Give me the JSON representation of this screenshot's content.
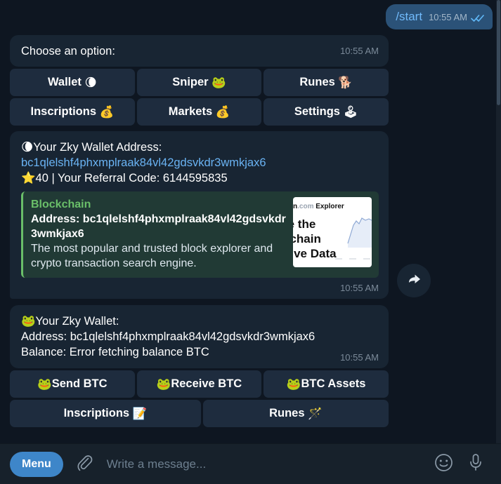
{
  "app": {
    "theme_background": "#0e1621"
  },
  "messages": {
    "outgoing": {
      "text": "/start",
      "time": "10:55 AM",
      "status_icon": "double-check-icon"
    },
    "choose_option": {
      "text": "Choose an option:",
      "time": "10:55 AM"
    },
    "wallet_address": {
      "line1_emoji": "🌘",
      "line1": "Your Zky Wallet Address:",
      "address": "bc1qlelshf4phxmplraak84vl42gdsvkdr3wmkjax6",
      "line3_emoji": "⭐",
      "line3": "40 | Your Referral Code: 6144595835",
      "time": "10:55 AM",
      "preview": {
        "site": "Blockchain",
        "title": "Address: bc1qlelshf4phxmplraak84vl42gdsvkdr3wmkjax6",
        "description": "The most popular and trusted block explorer and crypto transaction search engine.",
        "accent_color": "#6abf69",
        "thumbnail": {
          "brand": "chain",
          "brand_suffix": ".com",
          "brand_label": "Explorer",
          "headline_1": "re the",
          "headline_2": "kchain",
          "headline_3": "Live Data"
        }
      }
    },
    "wallet_summary": {
      "line1_emoji": "🐸",
      "line1": "Your Zky Wallet:",
      "line2": "Address: bc1qlelshf4phxmplraak84vl42gdsvkdr3wmkjax6",
      "line3": "Balance: Error fetching balance BTC",
      "time": "10:55 AM"
    }
  },
  "keyboard_main": {
    "rows": [
      [
        {
          "label": "Wallet",
          "emoji": "🌘"
        },
        {
          "label": "Sniper",
          "emoji": "🐸"
        },
        {
          "label": "Runes",
          "emoji": "🐕"
        }
      ],
      [
        {
          "label": "Inscriptions",
          "emoji": "💰"
        },
        {
          "label": "Markets",
          "emoji": "💰"
        },
        {
          "label": "Settings",
          "emoji": "🕹"
        }
      ]
    ]
  },
  "keyboard_wallet": {
    "rows": [
      [
        {
          "emoji": "🐸",
          "label": "Send BTC"
        },
        {
          "emoji": "🐸",
          "label": "Receive BTC"
        },
        {
          "emoji": "🐸",
          "label": "BTC Assets"
        }
      ],
      [
        {
          "label": "Inscriptions",
          "emoji": "📝"
        },
        {
          "label": "Runes",
          "emoji": "🪄"
        }
      ]
    ]
  },
  "composer": {
    "menu_label": "Menu",
    "placeholder": "Write a message...",
    "attach_icon": "paperclip-icon",
    "emoji_icon": "smiley-icon",
    "voice_icon": "microphone-icon"
  },
  "forward_button": {
    "icon": "forward-arrow-icon"
  }
}
